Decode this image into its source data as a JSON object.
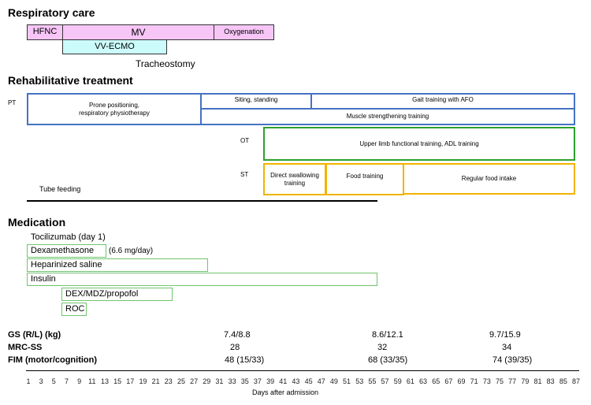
{
  "respiratory": {
    "heading": "Respiratory care",
    "hfnc": "HFNC",
    "mv": "MV",
    "oxygenation": "Oxygenation",
    "ecmo": "VV-ECMO",
    "tracheostomy": "Tracheostomy"
  },
  "rehab": {
    "heading": "Rehabilitative treatment",
    "pt_label": "PT",
    "prone": "Prone positioning,\nrespiratory physiotherapy",
    "sitting": "Siting, standing",
    "gait": "Gait training with AFO",
    "muscle": "Muscle strengthening training",
    "ot_label": "OT",
    "upper_limb": "Upper limb functional training, ADL training",
    "st_label": "ST",
    "swallow": "Direct swallowing\ntraining",
    "food_training": "Food training",
    "regular_food": "Regular food intake",
    "tube_feeding": "Tube feeding"
  },
  "medication": {
    "heading": "Medication",
    "tocilizumab": "Tocilizumab  (day 1)",
    "dexamethasone": "Dexamethasone",
    "dex_dose": "(6.6 mg/day)",
    "heparin": "Heparinized  saline",
    "insulin": "Insulin",
    "sedation": "DEX/MDZ/propofol",
    "roc": "ROC"
  },
  "outcomes": {
    "gs_label": "GS (R/L) (kg)",
    "mrc_label": "MRC-SS",
    "fim_label": "FIM (motor/cognition)",
    "gs": [
      "7.4/8.8",
      "8.6/12.1",
      "9.7/15.9"
    ],
    "mrc": [
      "28",
      "32",
      "34"
    ],
    "fim": [
      "48 (15/33)",
      "68 (33/35)",
      "74 (39/35)"
    ]
  },
  "axis": {
    "days": [
      "1",
      "3",
      "5",
      "7",
      "9",
      "11",
      "13",
      "15",
      "17",
      "19",
      "21",
      "23",
      "25",
      "27",
      "29",
      "31",
      "33",
      "35",
      "37",
      "39",
      "41",
      "43",
      "45",
      "47",
      "49",
      "51",
      "53",
      "55",
      "57",
      "59",
      "61",
      "63",
      "65",
      "67",
      "69",
      "71",
      "73",
      "75",
      "77",
      "79",
      "81",
      "83",
      "85",
      "87"
    ],
    "label": "Days after admission"
  },
  "colors": {
    "pink": "#f7c6f7",
    "cyan": "#ccfbfb",
    "blue": "#4472c4",
    "green": "#2ca02c",
    "yellow": "#f2b300",
    "med_green": "#6fc46f"
  }
}
